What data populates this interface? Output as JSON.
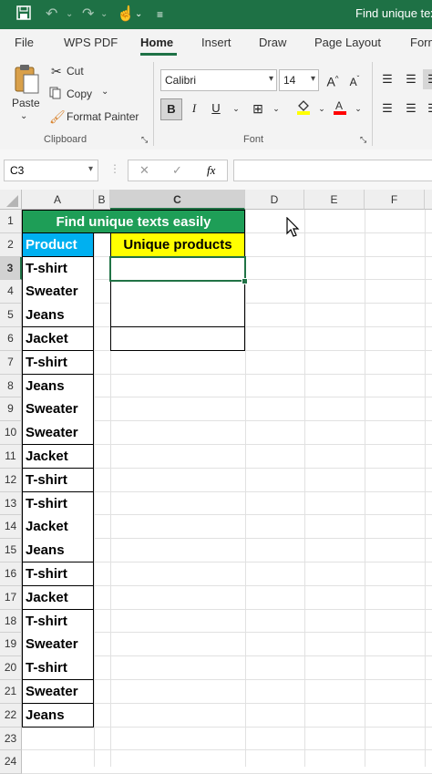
{
  "window": {
    "title": "Find unique tex",
    "quick_access": [
      "save",
      "undo",
      "redo",
      "touch-mode",
      "customize"
    ]
  },
  "menu": {
    "tabs": [
      "File",
      "WPS PDF",
      "Home",
      "Insert",
      "Draw",
      "Page Layout",
      "Form"
    ],
    "active": "Home"
  },
  "ribbon": {
    "clipboard": {
      "paste": "Paste",
      "cut": "Cut",
      "copy": "Copy",
      "format_painter": "Format Painter",
      "group_label": "Clipboard"
    },
    "font": {
      "font_name": "Calibri",
      "font_size": "14",
      "bold": "B",
      "italic": "I",
      "underline": "U",
      "group_label": "Font",
      "fill_color": "#ffff00",
      "font_color": "#ff0000"
    }
  },
  "formula_bar": {
    "name_box": "C3",
    "cancel": "✕",
    "enter": "✓",
    "fx": "fx",
    "formula": ""
  },
  "sheet": {
    "columns": [
      "A",
      "B",
      "C",
      "D",
      "E",
      "F"
    ],
    "selected_column": "C",
    "selected_row": "3",
    "title": "Find unique texts easily",
    "product_header": "Product",
    "unique_header": "Unique products",
    "products": [
      "T-shirt",
      "Sweater",
      "Jeans",
      "Jacket",
      "T-shirt",
      "Jeans",
      "Sweater",
      "Sweater",
      "Jacket",
      "T-shirt",
      "T-shirt",
      "Jacket",
      "Jeans",
      "T-shirt",
      "Jacket",
      "T-shirt",
      "Sweater",
      "T-shirt",
      "Sweater",
      "Jeans"
    ],
    "row_numbers": [
      "1",
      "2",
      "3",
      "4",
      "5",
      "6",
      "7",
      "8",
      "9",
      "10",
      "11",
      "12",
      "13",
      "14",
      "15",
      "16",
      "17",
      "18",
      "19",
      "20",
      "21",
      "22",
      "23",
      "24"
    ],
    "colors": {
      "title_bg": "#1e9e57",
      "header_bg": "#00b0f0",
      "unique_bg": "#ffff00",
      "selection": "#217346"
    }
  }
}
